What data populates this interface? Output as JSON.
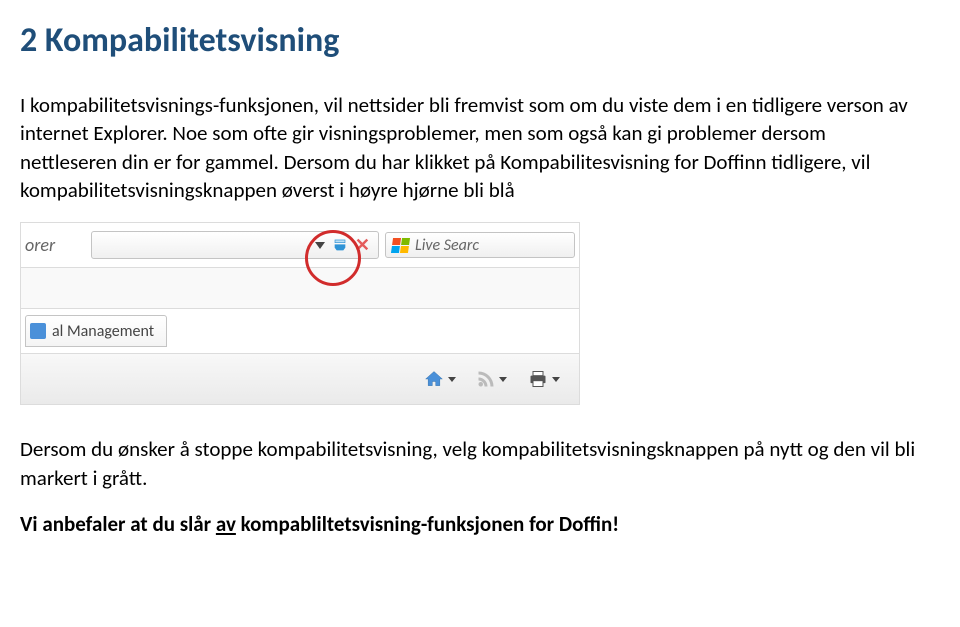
{
  "heading": "2  Kompabilitetsvisning",
  "paragraph1": "I kompabilitetsvisnings-funksjonen, vil nettsider bli fremvist som om du viste dem i en tidligere verson av internet Explorer. Noe som ofte gir visningsproblemer, men som også kan gi problemer dersom nettleseren din er for gammel. Dersom du har klikket på Kompabilitesvisning for Doffinn tidligere, vil kompabilitetsvisningsknappen øverst i høyre hjørne bli blå",
  "paragraph2": "Dersom du ønsker å stoppe kompabilitetsvisning, velg kompabilitetsvisningsknappen på nytt og den vil bli markert i grått.",
  "paragraph3_prefix": "Vi anbefaler at du slår ",
  "paragraph3_av": "av",
  "paragraph3_suffix": " kompabliltetsvisning-funksjonen for Doffin!",
  "screenshot": {
    "addr_fragment": "orer",
    "search_placeholder": "Live Searc",
    "tab_label": "al Management",
    "icons": {
      "dropdown": "dropdown-arrow",
      "compat": "compatibility-view-icon",
      "close": "close-icon",
      "winflag": "windows-flag-icon",
      "home": "home-icon",
      "rss": "rss-icon",
      "print": "print-icon",
      "highlight": "red-circle-highlight"
    }
  }
}
